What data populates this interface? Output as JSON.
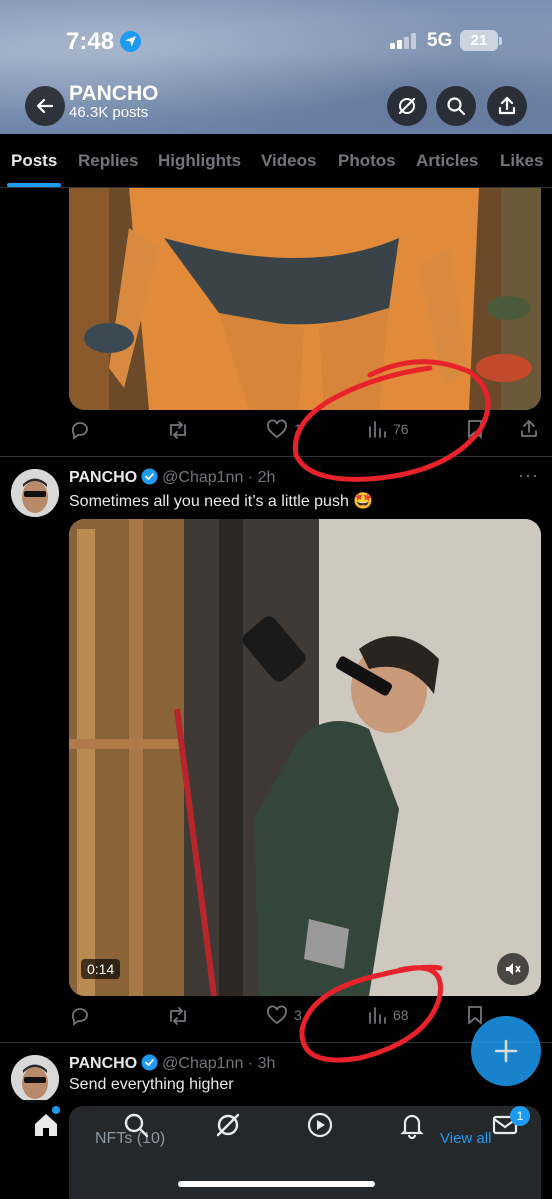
{
  "status_bar": {
    "time": "7:48",
    "network": "5G",
    "battery": "21"
  },
  "profile": {
    "name": "PANCHO",
    "posts_count": "46.3K posts"
  },
  "tabs": [
    {
      "label": "Posts"
    },
    {
      "label": "Replies"
    },
    {
      "label": "Highlights"
    },
    {
      "label": "Videos"
    },
    {
      "label": "Photos"
    },
    {
      "label": "Articles"
    },
    {
      "label": "Likes"
    }
  ],
  "posts": [
    {
      "likes": "1",
      "views": "76"
    },
    {
      "author": "PANCHO",
      "handle": "@Chap1nn",
      "time": "2h",
      "text": "Sometimes all you need it’s a little push 🤩",
      "video_duration": "0:14",
      "likes": "3",
      "views": "68"
    },
    {
      "author": "PANCHO",
      "handle": "@Chap1nn",
      "time": "3h",
      "text": "Send everything higher"
    }
  ],
  "sheet": {
    "label": "NFTs (10)",
    "link": "View all"
  },
  "badges": {
    "messages": "1"
  },
  "colors": {
    "accent": "#1d9bf0",
    "annotation": "#e8222a"
  }
}
